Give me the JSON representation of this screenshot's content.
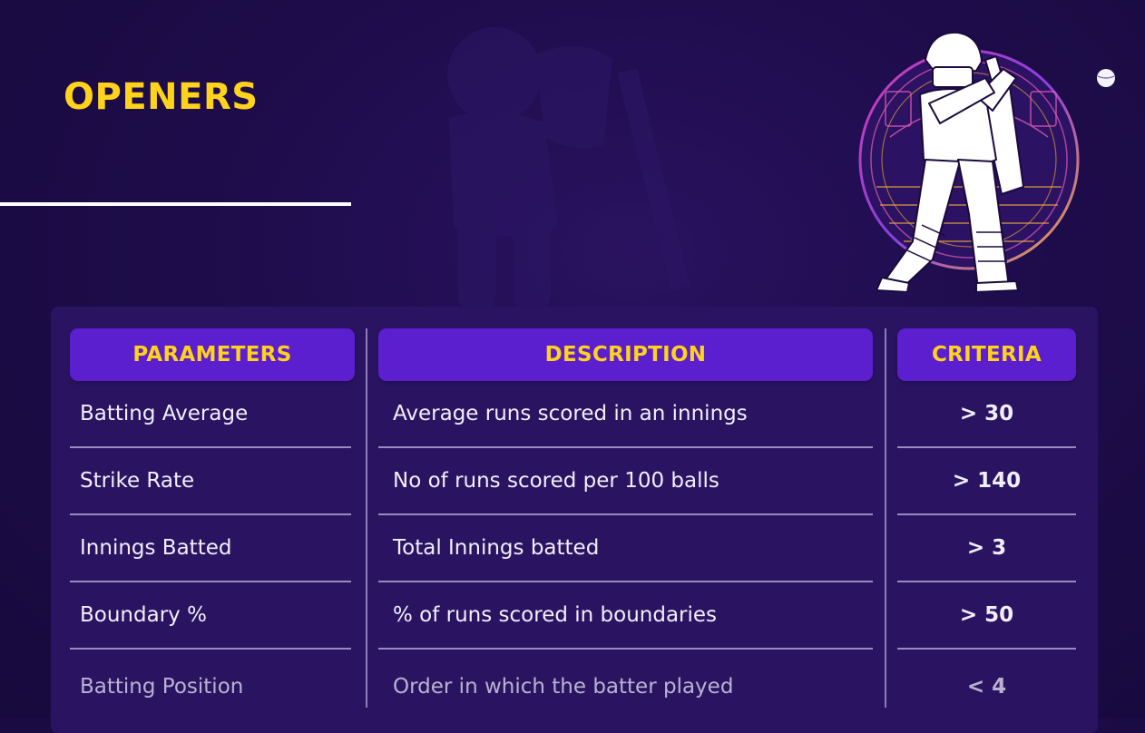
{
  "slide": {
    "title": "OPENERS"
  },
  "colors": {
    "background": "#1e0c4b",
    "accent_yellow": "#ffd21c",
    "header_purple": "#5b1fd0",
    "panel": "#2a1462"
  },
  "icons": {
    "hero": "cricket-batter-illustration",
    "ball": "cricket-ball-icon",
    "cursor": "mouse-cursor-icon"
  },
  "table": {
    "headers": {
      "parameters": "PARAMETERS",
      "description": "DESCRIPTION",
      "criteria": "CRITERIA"
    },
    "rows": [
      {
        "parameter": "Batting Average",
        "description": "Average runs scored in an innings",
        "criteria": "> 30"
      },
      {
        "parameter": "Strike Rate",
        "description": "No of runs scored per 100 balls",
        "criteria": "> 140"
      },
      {
        "parameter": "Innings Batted",
        "description": "Total Innings batted",
        "criteria": "> 3"
      },
      {
        "parameter": "Boundary %",
        "description": "% of runs scored in boundaries",
        "criteria": "> 50"
      },
      {
        "parameter": "Batting Position",
        "description": "Order in which the batter played",
        "criteria": "< 4"
      }
    ]
  }
}
